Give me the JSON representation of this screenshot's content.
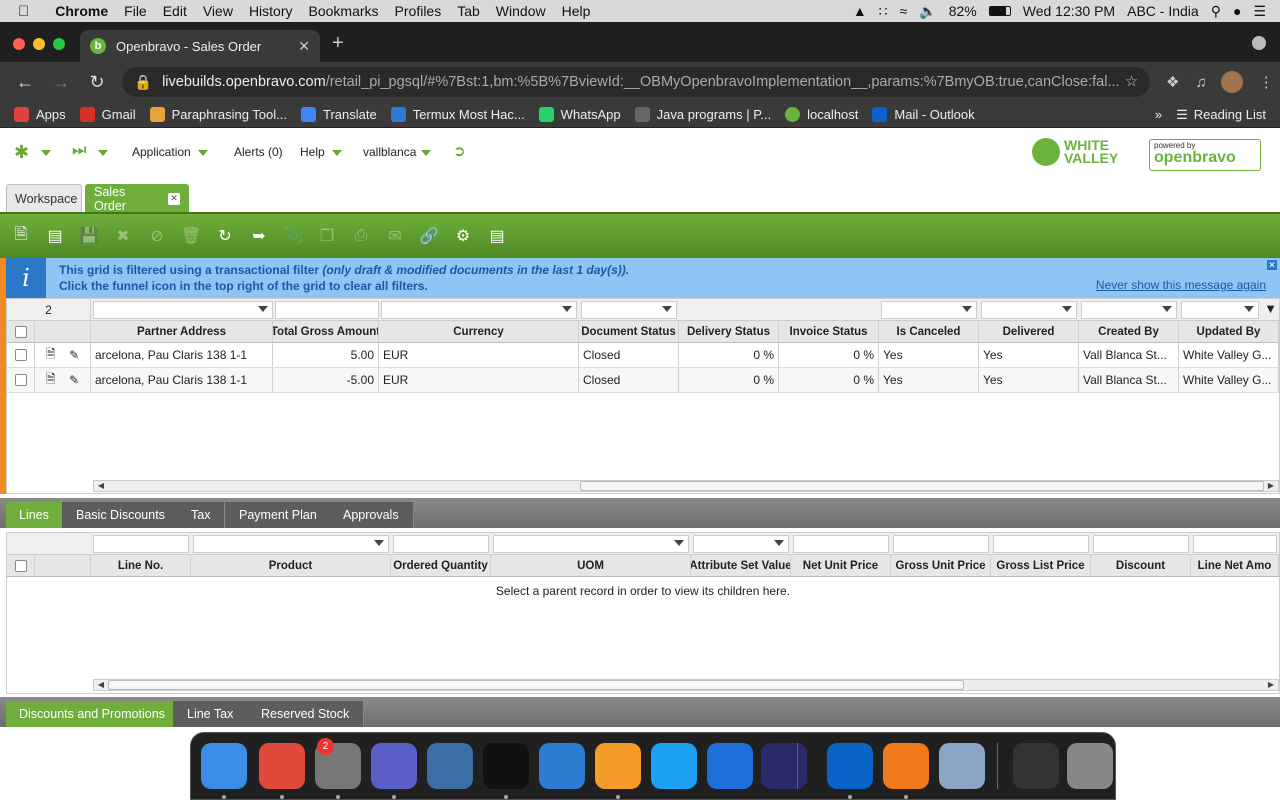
{
  "macos_menubar": {
    "app": "Chrome",
    "menus": [
      "File",
      "Edit",
      "View",
      "History",
      "Bookmarks",
      "Profiles",
      "Tab",
      "Window",
      "Help"
    ],
    "battery": "82%",
    "clock": "Wed 12:30 PM",
    "input_source": "ABC - India"
  },
  "browser": {
    "tab_title": "Openbravo - Sales Order",
    "tab_favicon": "b",
    "url_host": "livebuilds.openbravo.com",
    "url_path": "/retail_pi_pgsql/#%7Bst:1,bm:%5B%7BviewId:__OBMyOpenbravoImplementation__,params:%7BmyOB:true,canClose:fal...",
    "bookmarks": [
      "Apps",
      "Gmail",
      "Paraphrasing Tool...",
      "Translate",
      "Termux Most Hac...",
      "WhatsApp",
      "Java programs | P...",
      "localhost",
      "Mail - Outlook"
    ],
    "bookmark_colors": [
      "#e04040",
      "#d93025",
      "#e8a33c",
      "#4285f4",
      "#2d7bd6",
      "#25d366",
      "#666666",
      "#6cb33e",
      "#0a64c8"
    ],
    "reading_list": "Reading List"
  },
  "app": {
    "nav": {
      "application": "Application",
      "alerts": "Alerts (0)",
      "help": "Help",
      "user": "vallblanca"
    },
    "logo_wv_line1": "WHITE",
    "logo_wv_line2": "VALLEY",
    "logo_ob_powered": "powered by",
    "logo_ob_name": "openbravo",
    "main_tabs": [
      {
        "label": "Workspace"
      },
      {
        "label": "Sales Order"
      }
    ],
    "info": {
      "line1_bold": "This grid is filtered using a transactional filter ",
      "line1_italic": "(only draft & modified documents in the last 1 day(s)).",
      "line2": "Click the funnel icon in the top right of the grid to clear all filters.",
      "never_show": "Never show this message again"
    },
    "header_grid": {
      "record_count": "2",
      "columns": [
        "Partner Address",
        "Total Gross Amount",
        "Currency",
        "Document Status",
        "Delivery Status",
        "Invoice Status",
        "Is Canceled",
        "Delivered",
        "Created By",
        "Updated By"
      ],
      "rows": [
        [
          "arcelona, Pau Claris 138 1-1",
          "5.00",
          "EUR",
          "Closed",
          "0 %",
          "0 %",
          "Yes",
          "Yes",
          "Vall Blanca St...",
          "White Valley G..."
        ],
        [
          "arcelona, Pau Claris 138 1-1",
          "-5.00",
          "EUR",
          "Closed",
          "0 %",
          "0 %",
          "Yes",
          "Yes",
          "Vall Blanca St...",
          "White Valley G..."
        ]
      ]
    },
    "sub_tabs": [
      "Lines",
      "Basic Discounts",
      "Tax",
      "Payment Plan",
      "Approvals"
    ],
    "lines_grid": {
      "columns": [
        "Line No.",
        "Product",
        "Ordered Quantity",
        "UOM",
        "Attribute Set Value",
        "Net Unit Price",
        "Gross Unit Price",
        "Gross List Price",
        "Discount",
        "Line Net Amo"
      ],
      "empty_message": "Select a parent record in order to view its children here."
    },
    "bottom_tabs": [
      "Discounts and Promotions",
      "Line Tax",
      "Reserved Stock"
    ]
  },
  "dock": {
    "notification_badge": "2",
    "icon_colors": [
      "#3a8ee6",
      "#e04a3a",
      "#777777",
      "#5a5fc7",
      "#3b6ea5",
      "#111111",
      "#2b7bd1",
      "#f59b2a",
      "#1da1f2",
      "#1e6fd9",
      "#2a2a6a",
      "#0a64c8",
      "#f07a1a",
      "#8aa5c8",
      "#333333",
      "#888888"
    ],
    "icons": [
      "finder-icon",
      "chrome-icon",
      "system-preferences-icon",
      "teams-icon",
      "postgresql-icon",
      "terminal-icon",
      "vscode-icon",
      "sublime-icon",
      "skype-icon",
      "signal-icon",
      "eclipse-icon",
      "outlook-icon",
      "vlc-icon",
      "preview-icon",
      "screen-icon",
      "trash-icon"
    ]
  }
}
